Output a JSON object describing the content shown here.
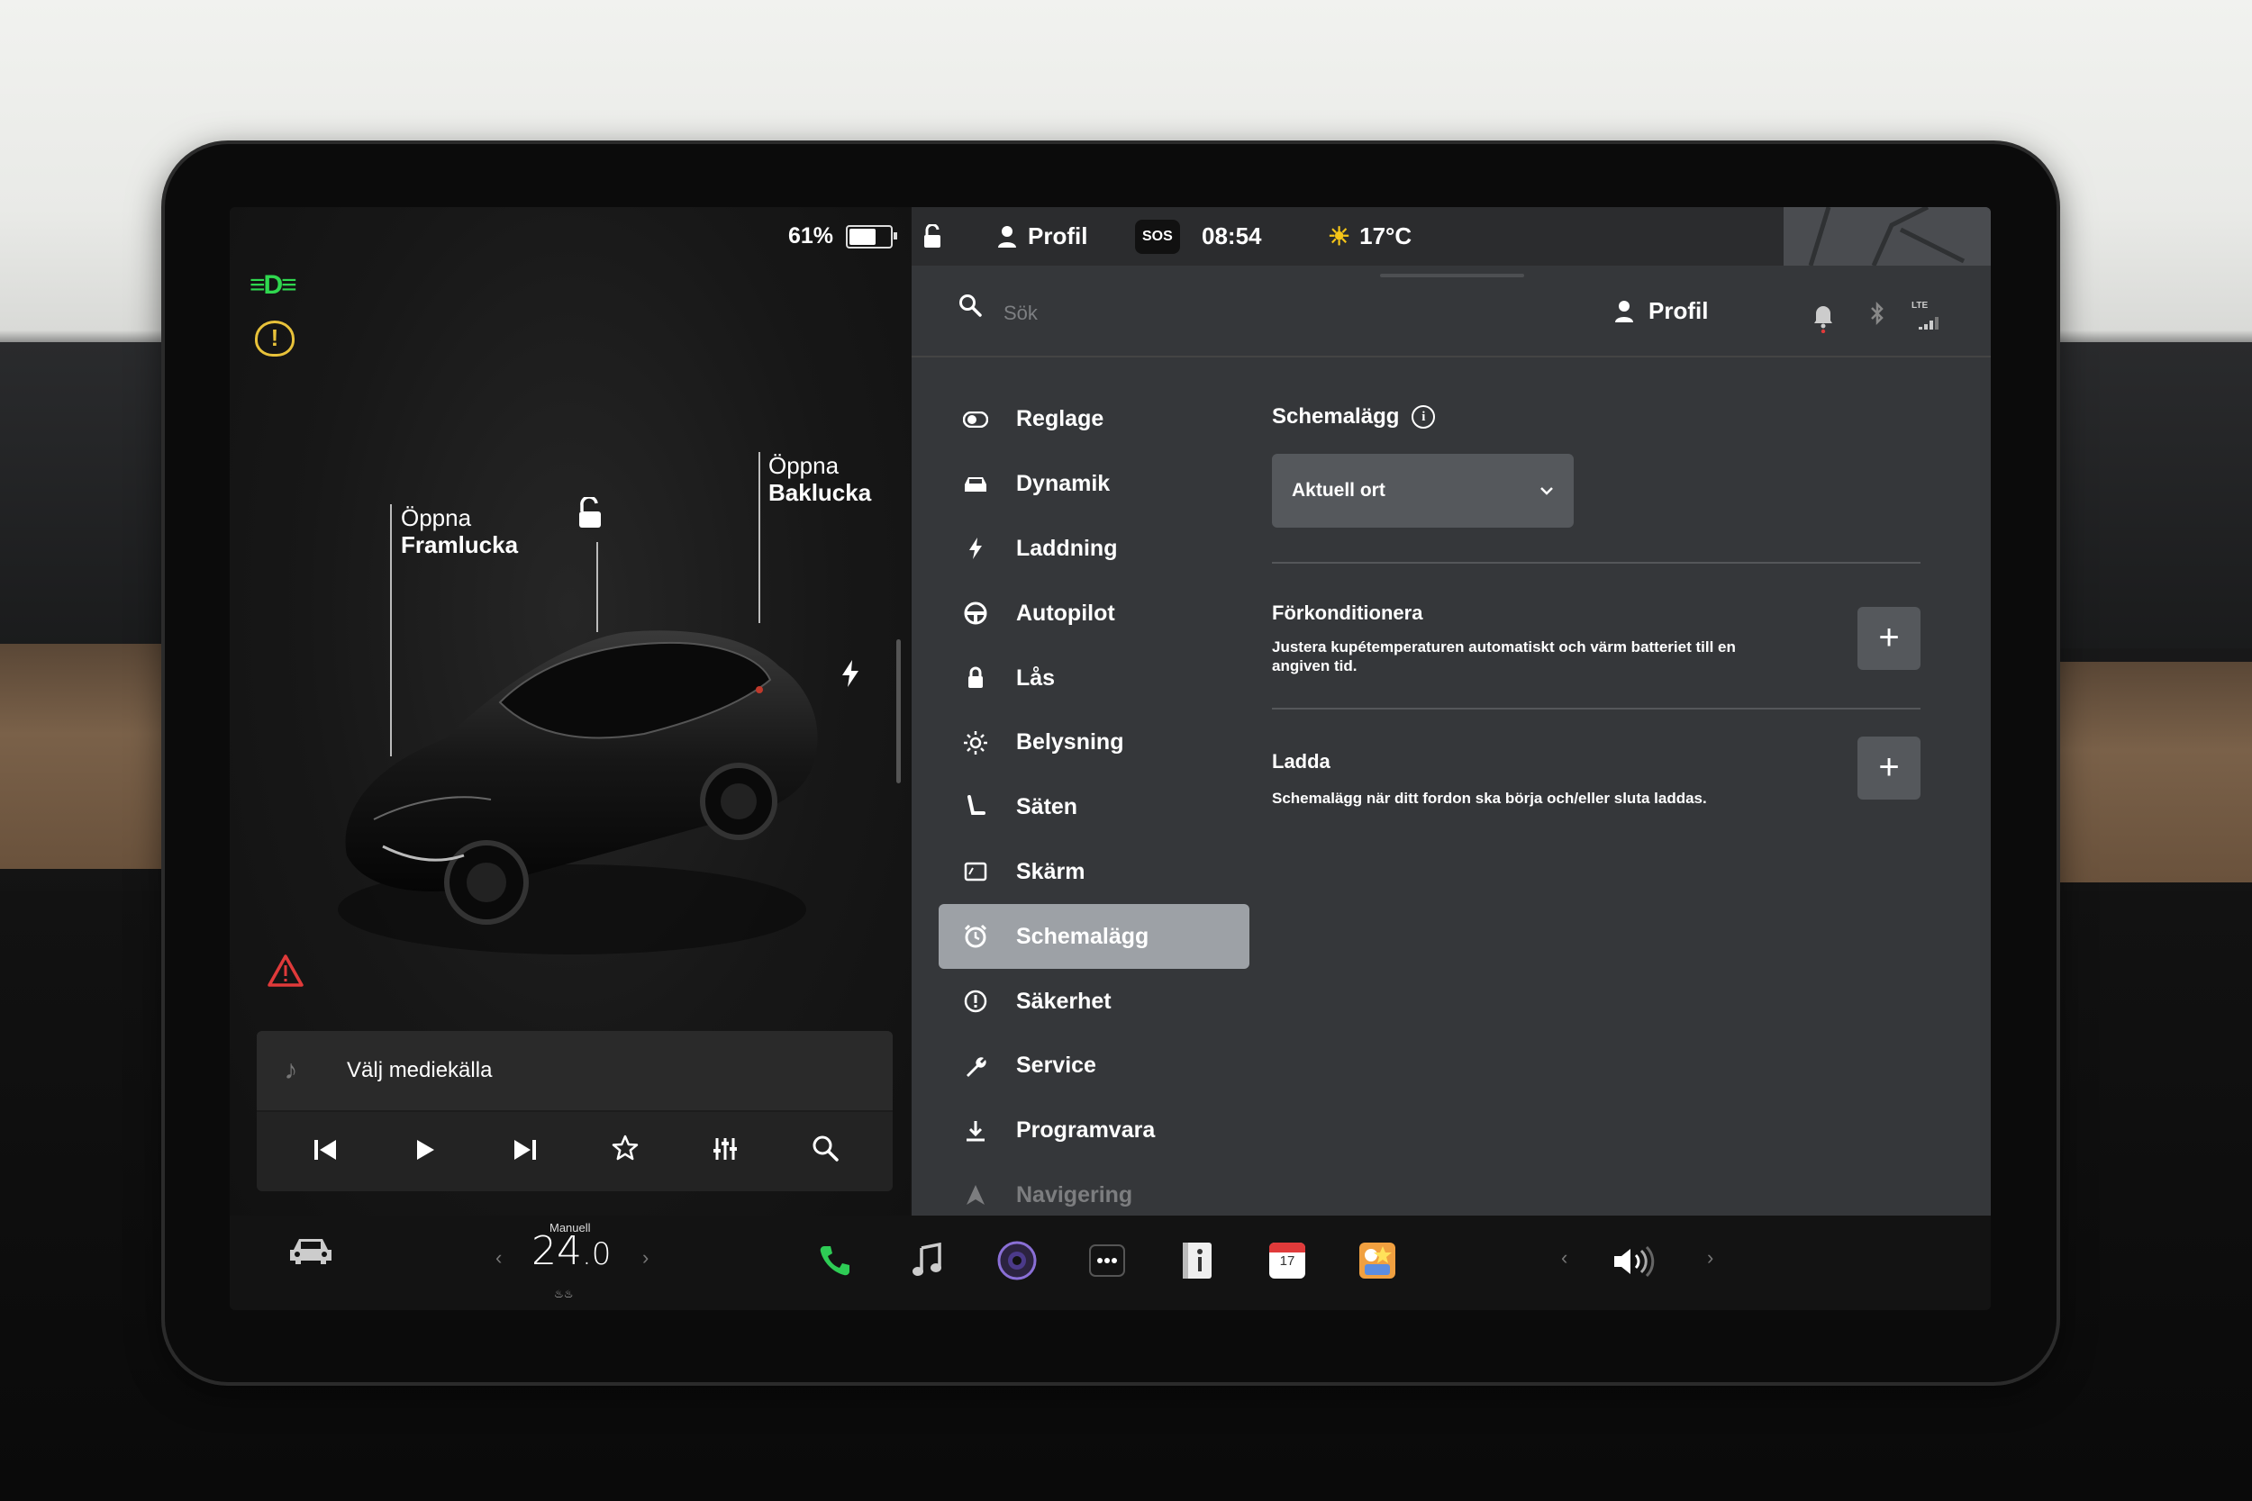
{
  "status": {
    "battery_percent": "61%",
    "battery_level": 0.61,
    "profile_label": "Profil",
    "sos_label": "SOS",
    "time": "08:54",
    "temperature": "17°C"
  },
  "left_panel": {
    "front_trunk_line1": "Öppna",
    "front_trunk_line2": "Framlucka",
    "rear_trunk_line1": "Öppna",
    "rear_trunk_line2": "Baklucka",
    "media_source": "Välj mediekälla"
  },
  "search": {
    "placeholder": "Sök",
    "profile_label": "Profil",
    "network_label": "LTE"
  },
  "menu": {
    "items": [
      {
        "label": "Reglage",
        "icon": "toggle-icon"
      },
      {
        "label": "Dynamik",
        "icon": "car-icon"
      },
      {
        "label": "Laddning",
        "icon": "bolt-icon"
      },
      {
        "label": "Autopilot",
        "icon": "steering-wheel-icon"
      },
      {
        "label": "Lås",
        "icon": "lock-icon"
      },
      {
        "label": "Belysning",
        "icon": "sun-icon"
      },
      {
        "label": "Säten",
        "icon": "seat-icon"
      },
      {
        "label": "Skärm",
        "icon": "display-icon"
      },
      {
        "label": "Schemalägg",
        "icon": "alarm-clock-icon",
        "active": true
      },
      {
        "label": "Säkerhet",
        "icon": "alert-circle-icon"
      },
      {
        "label": "Service",
        "icon": "wrench-icon"
      },
      {
        "label": "Programvara",
        "icon": "download-icon"
      },
      {
        "label": "Navigering",
        "icon": "navigation-icon"
      }
    ]
  },
  "schedule": {
    "title": "Schemalägg",
    "location_selected": "Aktuell ort",
    "precondition_title": "Förkonditionera",
    "precondition_desc": "Justera kupétemperaturen automatiskt och värm batteriet till en angiven tid.",
    "charge_title": "Ladda",
    "charge_desc": "Schemalägg när ditt fordon ska börja och/eller sluta laddas.",
    "add_symbol": "+"
  },
  "dock": {
    "temp_mode": "Manuell",
    "temp_whole": "24",
    "temp_decimal": ".0",
    "calendar_day": "17"
  },
  "colors": {
    "accent_active": "#9da1a6",
    "headlight_green": "#2fd84f",
    "tire_warning": "#e8c23a",
    "warning_red": "#e03a3a",
    "phone_green": "#2ecc55"
  }
}
